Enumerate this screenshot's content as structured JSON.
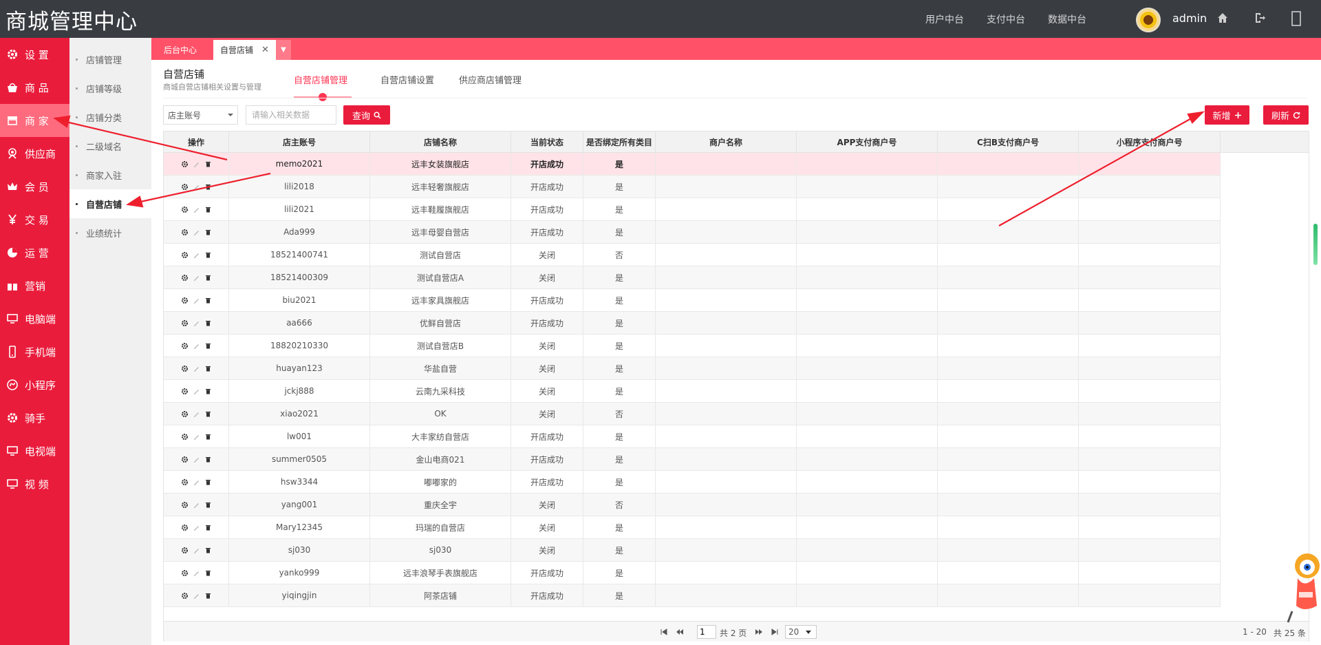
{
  "header": {
    "brand": "商城管理中心",
    "nav": [
      "用户中台",
      "支付中台",
      "数据中台"
    ],
    "username": "admin",
    "icons": [
      "home-icon",
      "logout-icon",
      "fullscreen-icon"
    ]
  },
  "sidebar": {
    "items": [
      {
        "label": "设 置",
        "icon": "gear-icon"
      },
      {
        "label": "商 品",
        "icon": "basket-icon"
      },
      {
        "label": "商 家",
        "icon": "store-icon"
      },
      {
        "label": "供应商",
        "icon": "supplier-icon"
      },
      {
        "label": "会 员",
        "icon": "crown-icon"
      },
      {
        "label": "交 易",
        "icon": "yen-icon"
      },
      {
        "label": "运 营",
        "icon": "pie-icon"
      },
      {
        "label": "营销",
        "icon": "gift-icon"
      },
      {
        "label": "电脑端",
        "icon": "monitor-icon"
      },
      {
        "label": "手机端",
        "icon": "mobile-icon"
      },
      {
        "label": "小程序",
        "icon": "miniprogram-icon"
      },
      {
        "label": "骑手",
        "icon": "gear-icon"
      },
      {
        "label": "电视端",
        "icon": "monitor-icon"
      },
      {
        "label": "视 频",
        "icon": "monitor-icon"
      }
    ],
    "active_index": 2
  },
  "subnav": {
    "items": [
      "店铺管理",
      "店铺等级",
      "店铺分类",
      "二级域名",
      "商家入驻",
      "自营店铺",
      "业绩统计"
    ],
    "active_index": 5
  },
  "tabs": {
    "items": [
      {
        "label": "后台中心"
      },
      {
        "label": "自营店铺",
        "close": "✕"
      }
    ],
    "more_icon": "▼"
  },
  "page": {
    "title": "自营店铺",
    "subtitle": "商城自营店铺相关设置与管理",
    "subtabs": [
      "自营店铺管理",
      "自营店铺设置",
      "供应商店铺管理"
    ]
  },
  "toolbar": {
    "select_value": "店主账号",
    "search_placeholder": "请输入相关数据",
    "search_value": "",
    "query_label": "查询",
    "add_label": "新增",
    "refresh_label": "刷新"
  },
  "table": {
    "columns": [
      "操作",
      "店主账号",
      "店铺名称",
      "当前状态",
      "是否绑定所有类目",
      "商户名称",
      "APP支付商户号",
      "C扫B支付商户号",
      "小程序支付商户号"
    ],
    "rows": [
      [
        "memo2021",
        "远丰女装旗舰店",
        "开店成功",
        "是"
      ],
      [
        "lili2018",
        "远丰轻奢旗舰店",
        "开店成功",
        "是"
      ],
      [
        "lili2021",
        "远丰鞋履旗舰店",
        "开店成功",
        "是"
      ],
      [
        "Ada999",
        "远丰母婴自营店",
        "开店成功",
        "是"
      ],
      [
        "18521400741",
        "测试自营店",
        "关闭",
        "否"
      ],
      [
        "18521400309",
        "测试自营店A",
        "关闭",
        "是"
      ],
      [
        "biu2021",
        "远丰家具旗舰店",
        "开店成功",
        "是"
      ],
      [
        "aa666",
        "优鲜自营店",
        "开店成功",
        "是"
      ],
      [
        "18820210330",
        "测试自营店B",
        "关闭",
        "是"
      ],
      [
        "huayan123",
        "华盐自营",
        "关闭",
        "是"
      ],
      [
        "jckj888",
        "云南九采科技",
        "关闭",
        "是"
      ],
      [
        "xiao2021",
        "OK",
        "关闭",
        "否"
      ],
      [
        "lw001",
        "大丰家纺自营店",
        "开店成功",
        "是"
      ],
      [
        "summer0505",
        "金山电商021",
        "开店成功",
        "是"
      ],
      [
        "hsw3344",
        "嘟嘟家的",
        "开店成功",
        "是"
      ],
      [
        "yang001",
        "重庆全宇",
        "关闭",
        "否"
      ],
      [
        "Mary12345",
        "玛瑞的自营店",
        "关闭",
        "是"
      ],
      [
        "sj030",
        "sj030",
        "关闭",
        "是"
      ],
      [
        "yanko999",
        "远丰浪琴手表旗舰店",
        "开店成功",
        "是"
      ],
      [
        "yiqingjin",
        "阿茶店铺",
        "开店成功",
        "是"
      ]
    ]
  },
  "pager": {
    "current_page": "1",
    "total_pages": "共 2 页",
    "page_size": "20",
    "range": "1 - 20",
    "total": "共 25 条"
  },
  "colors": {
    "accent": "#ea1c3c",
    "tabbar": "#ff5268",
    "header": "#393d42",
    "highlight_row": "#ffe3e8"
  }
}
